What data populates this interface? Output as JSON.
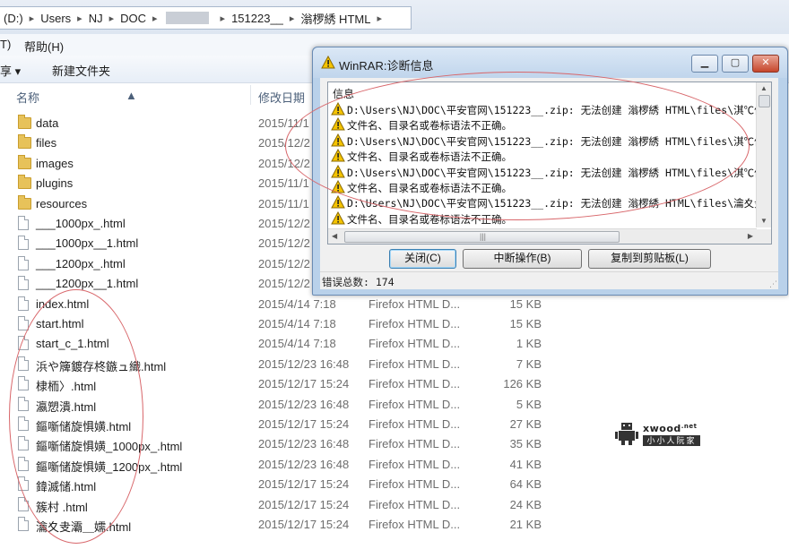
{
  "explorer": {
    "breadcrumb": {
      "items": [
        "(D:)",
        "Users",
        "NJ",
        "DOC",
        "151223__",
        "滃椤綉 HTML"
      ]
    },
    "menu": {
      "partial_item": "T)",
      "help": "帮助(H)"
    },
    "toolbar": {
      "share": "享 ▾",
      "new_folder": "新建文件夹"
    },
    "columns": {
      "name": "名称",
      "modified": "修改日期"
    },
    "files": [
      {
        "name": "data",
        "kind": "folder",
        "date": "2015/11/1",
        "type": "",
        "size": ""
      },
      {
        "name": "files",
        "kind": "folder",
        "date": "2015/12/2",
        "type": "",
        "size": ""
      },
      {
        "name": "images",
        "kind": "folder",
        "date": "2015/12/2",
        "type": "",
        "size": ""
      },
      {
        "name": "plugins",
        "kind": "folder",
        "date": "2015/11/1",
        "type": "",
        "size": ""
      },
      {
        "name": "resources",
        "kind": "folder",
        "date": "2015/11/1",
        "type": "",
        "size": ""
      },
      {
        "name": "___1000px_.html",
        "kind": "file",
        "date": "2015/12/2",
        "type": "",
        "size": ""
      },
      {
        "name": "___1000px__1.html",
        "kind": "file",
        "date": "2015/12/2",
        "type": "",
        "size": ""
      },
      {
        "name": "___1200px_.html",
        "kind": "file",
        "date": "2015/12/2",
        "type": "",
        "size": ""
      },
      {
        "name": "___1200px__1.html",
        "kind": "file",
        "date": "2015/12/2",
        "type": "",
        "size": ""
      },
      {
        "name": "index.html",
        "kind": "file",
        "date": "2015/4/14 7:18",
        "type": "Firefox HTML D...",
        "size": "15 KB"
      },
      {
        "name": "start.html",
        "kind": "file",
        "date": "2015/4/14 7:18",
        "type": "Firefox HTML D...",
        "size": "15 KB"
      },
      {
        "name": "start_c_1.html",
        "kind": "file",
        "date": "2015/4/14 7:18",
        "type": "Firefox HTML D...",
        "size": "1 KB"
      },
      {
        "name": "浜や簰鍍存柊鏃ュ織.html",
        "kind": "file",
        "date": "2015/12/23 16:48",
        "type": "Firefox HTML D...",
        "size": "7 KB"
      },
      {
        "name": "棣栭〉.html",
        "kind": "file",
        "date": "2015/12/17 15:24",
        "type": "Firefox HTML D...",
        "size": "126 KB"
      },
      {
        "name": "瀛愬潰.html",
        "kind": "file",
        "date": "2015/12/23 16:48",
        "type": "Firefox HTML D...",
        "size": "5 KB"
      },
      {
        "name": "鏂噺储旋惧嫹.html",
        "kind": "file",
        "date": "2015/12/17 15:24",
        "type": "Firefox HTML D...",
        "size": "27 KB"
      },
      {
        "name": "鏂噺储旋惧嫹_1000px_.html",
        "kind": "file",
        "date": "2015/12/23 16:48",
        "type": "Firefox HTML D...",
        "size": "35 KB"
      },
      {
        "name": "鏂噺储旋惧嫹_1200px_.html",
        "kind": "file",
        "date": "2015/12/23 16:48",
        "type": "Firefox HTML D...",
        "size": "41 KB"
      },
      {
        "name": "鍏滅储.html",
        "kind": "file",
        "date": "2015/12/17 15:24",
        "type": "Firefox HTML D...",
        "size": "64 KB"
      },
      {
        "name": "簇村   .html",
        "kind": "file",
        "date": "2015/12/17 15:24",
        "type": "Firefox HTML D...",
        "size": "24 KB"
      },
      {
        "name": "瀹夊叏灞＿嬬.html",
        "kind": "file",
        "date": "2015/12/17 15:24",
        "type": "Firefox HTML D...",
        "size": "21 KB"
      }
    ]
  },
  "dialog": {
    "title": "WinRAR:诊断信息",
    "window_buttons": {
      "minimize": "▁",
      "maximize": "▢",
      "close": "✕"
    },
    "list_header": "信息",
    "messages": [
      {
        "text": "D:\\Users\\NJ\\DOC\\平安官网\\151223__.zip: 无法创建 滃椤綉 HTML\\files\\淇℃伅"
      },
      {
        "text": "文件名、目录名或卷标语法不正确。"
      },
      {
        "text": "D:\\Users\\NJ\\DOC\\平安官网\\151223__.zip: 无法创建 滃椤綉 HTML\\files\\淇℃伅"
      },
      {
        "text": "文件名、目录名或卷标语法不正确。"
      },
      {
        "text": "D:\\Users\\NJ\\DOC\\平安官网\\151223__.zip: 无法创建 滃椤綉 HTML\\files\\淇℃伅"
      },
      {
        "text": "文件名、目录名或卷标语法不正确。"
      },
      {
        "text": "D:\\Users\\NJ\\DOC\\平安官网\\151223__.zip: 无法创建 滃椤綉 HTML\\files\\瀹夊叏"
      },
      {
        "text": "文件名、目录名或卷标语法不正确。"
      }
    ],
    "buttons": {
      "close": "关闭(C)",
      "abort": "中断操作(B)",
      "copy": "复制到剪贴板(L)"
    },
    "status": "错误总数: 174"
  },
  "watermark": {
    "site": "xwood",
    "tld": ".net",
    "slogan": "小小人阮家"
  },
  "colors": {
    "annotation_oval": "#d8666a",
    "warning_yellow": "#f5c400",
    "dialog_frame": "#b9d1ea"
  }
}
